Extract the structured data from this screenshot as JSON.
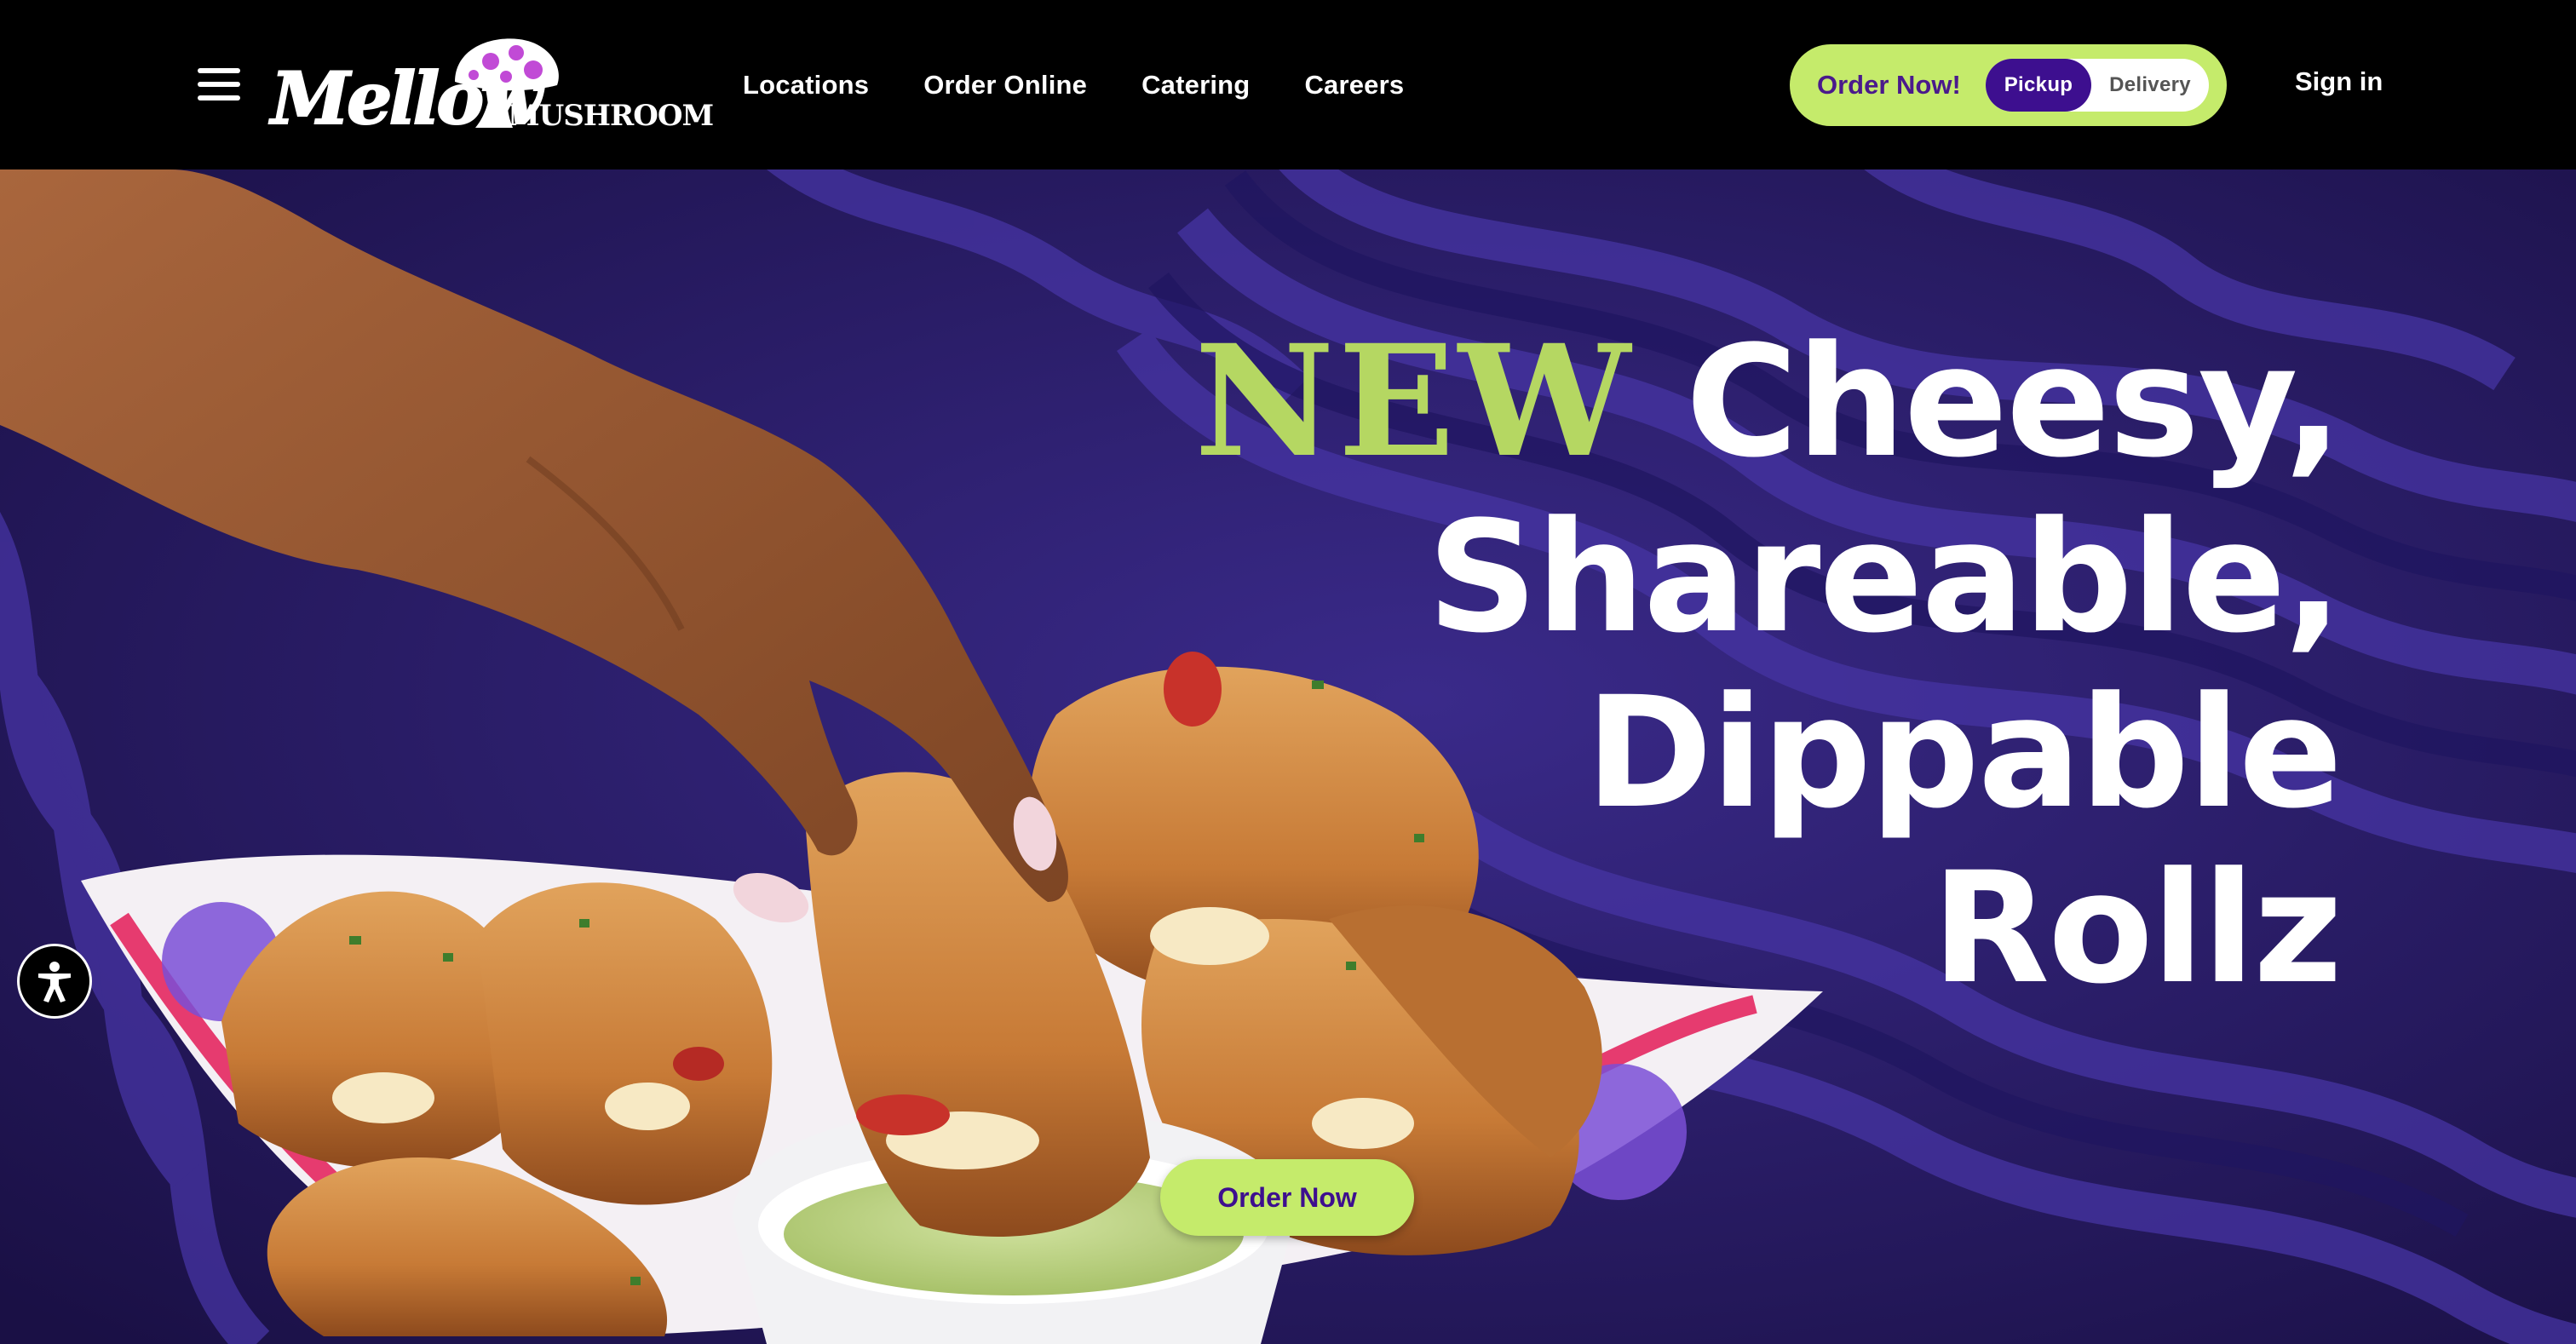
{
  "brand": {
    "logo_script": "Mellow",
    "logo_word": "MUSHROOM",
    "colors": {
      "accent_green": "#c5eb6b",
      "headline_green": "#b5d762",
      "brand_purple": "#3d0f8f",
      "hero_purple": "#2a1b6e"
    }
  },
  "header": {
    "menu_icon": "hamburger-icon",
    "nav": [
      {
        "label": "Locations"
      },
      {
        "label": "Order Online"
      },
      {
        "label": "Catering"
      },
      {
        "label": "Careers"
      }
    ],
    "order": {
      "label": "Order Now!",
      "pickup": "Pickup",
      "delivery": "Delivery",
      "selected": "Pickup"
    },
    "sign_in": "Sign in"
  },
  "hero": {
    "headline_new": "NEW",
    "headline_line1": "Cheesy,",
    "headline_line2": "Shareable,",
    "headline_line3": "Dippable",
    "headline_line4": "Rollz",
    "cta": "Order Now"
  },
  "accessibility": {
    "icon": "accessibility-icon"
  }
}
